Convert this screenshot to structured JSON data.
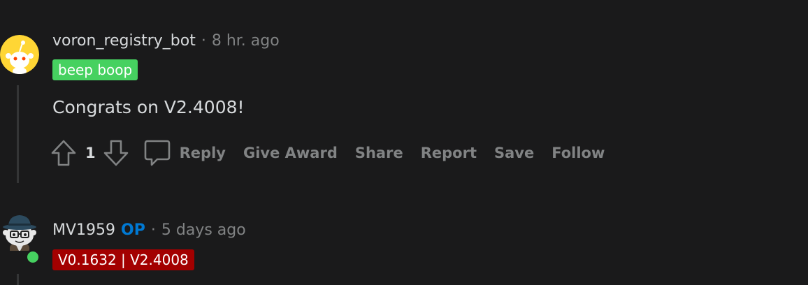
{
  "comments": [
    {
      "username": "voron_registry_bot",
      "time": "8 hr. ago",
      "flair": "beep boop",
      "body": "Congrats on V2.4008!",
      "votes": "1",
      "actions": {
        "reply": "Reply",
        "give_award": "Give Award",
        "share": "Share",
        "report": "Report",
        "save": "Save",
        "follow": "Follow"
      }
    },
    {
      "username": "MV1959",
      "op_label": "OP",
      "time": "5 days ago",
      "flair": "V0.1632 | V2.4008"
    }
  ],
  "separator": "·",
  "colors": {
    "background": "#1a1a1b",
    "bot_flair": "#46d160",
    "op_flair": "#a30000",
    "op_label": "#0079d3",
    "online": "#46d160"
  },
  "icons": {
    "upvote": "arrow-up-outline",
    "downvote": "arrow-down-outline",
    "reply": "speech-bubble-outline",
    "bot_avatar": "snoo-robot",
    "user_avatar": "snoo-detective"
  }
}
